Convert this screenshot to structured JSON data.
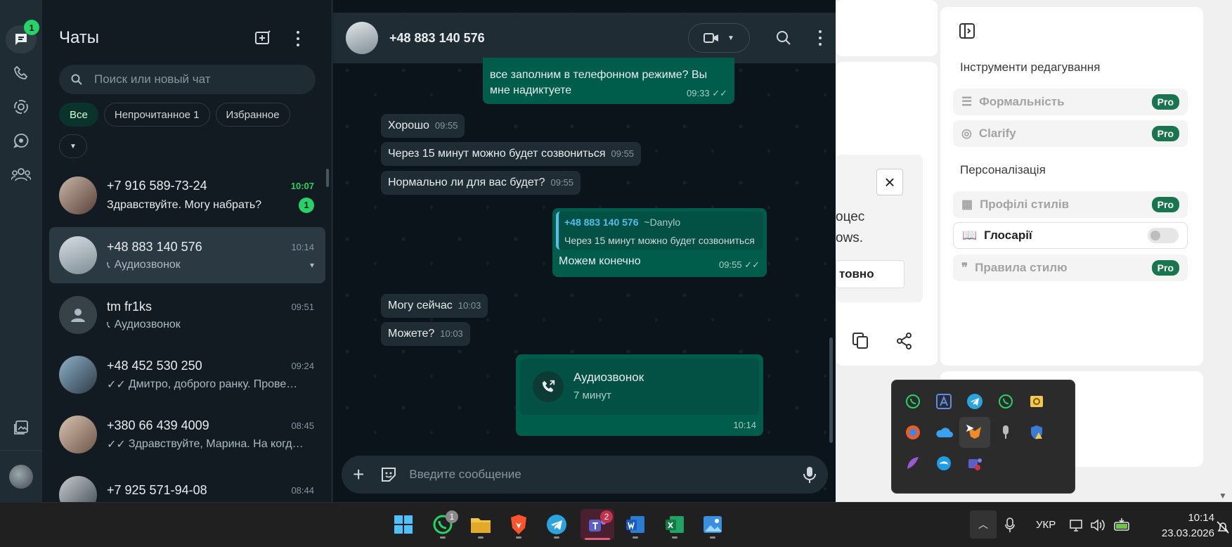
{
  "whatsapp": {
    "rail_badge": "1",
    "list_title": "Чаты",
    "search_placeholder": "Поиск или новый чат",
    "filters": [
      "Все",
      "Непрочитанное 1",
      "Избранное"
    ],
    "chats": [
      {
        "name": "+7 916 589-73-24",
        "time": "10:07",
        "preview": "Здравствуйте. Могу набрать?",
        "unread": "1",
        "icon": "none"
      },
      {
        "name": "+48 883 140 576",
        "time": "10:14",
        "preview": "Аудиозвонок",
        "icon": "call-icon"
      },
      {
        "name": "tm fr1ks",
        "time": "09:51",
        "preview": "Аудиозвонок",
        "icon": "call-icon"
      },
      {
        "name": "+48 452 530 250",
        "time": "09:24",
        "preview": "Дмитро, доброго ранку. Прове…",
        "icon": "double-check-icon"
      },
      {
        "name": "+380 66 439 4009",
        "time": "08:45",
        "preview": "Здравствуйте, Марина. На когд…",
        "icon": "double-check-icon"
      },
      {
        "name": "+7 925 571-94-08",
        "time": "08:44",
        "preview": "",
        "icon": "none"
      }
    ],
    "chat_title": "+48 883 140 576",
    "messages": {
      "m1_text": "все заполним в телефонном режиме? Вы мне надиктуете",
      "m1_time": "09:33",
      "m2_text": "Хорошо",
      "m2_time": "09:55",
      "m3_text": "Через 15 минут можно будет созвониться",
      "m3_time": "09:55",
      "m4_text": "Нормально ли для вас будет?",
      "m4_time": "09:55",
      "m5_quote_author": "+48 883 140 576",
      "m5_quote_alias": "~Danylo",
      "m5_quote_text": "Через 15 минут можно будет созвониться",
      "m5_text": "Можем конечно",
      "m5_time": "09:55",
      "m6_text": "Могу сейчас",
      "m6_time": "10:03",
      "m7_text": "Можете?",
      "m7_time": "10:03",
      "call_title": "Аудиозвонок",
      "call_duration": "7 минут",
      "call_time": "10:14"
    },
    "composer_placeholder": "Введите сообщение"
  },
  "doc_app": {
    "section_editing": "Інструменти редагування",
    "row_formality": "Формальність",
    "row_clarify": "Clarify",
    "section_personal": "Персоналізація",
    "row_style_profiles": "Профілі стилів",
    "row_glossaries": "Глосарії",
    "row_style_rules": "Правила стилю",
    "pro_label": "Pro",
    "frag_1": "оцес",
    "frag_2": "ows.",
    "ready_label": "товно"
  },
  "taskbar": {
    "whatsapp_badge": "1",
    "teams_badge": "2",
    "language": "УКР",
    "time": "10:14",
    "date": "23.03.2026"
  }
}
